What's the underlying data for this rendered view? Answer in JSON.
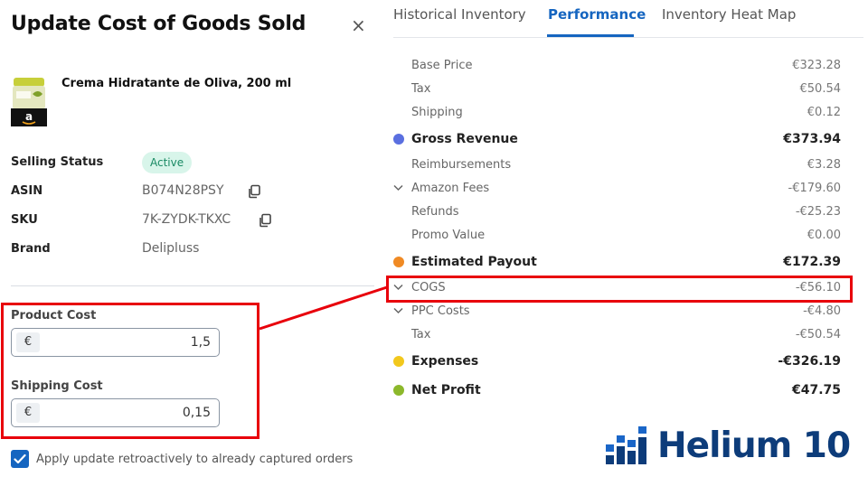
{
  "panel": {
    "title": "Update Cost of Goods Sold",
    "close_label": "×"
  },
  "product": {
    "name": "Crema Hidratante de Oliva, 200 ml",
    "image_icon": "product-jar-icon",
    "marketplace_icon": "amazon-icon"
  },
  "details": [
    {
      "label": "Selling Status",
      "value": "Active",
      "type": "badge"
    },
    {
      "label": "ASIN",
      "value": "B074N28PSY",
      "type": "copy"
    },
    {
      "label": "SKU",
      "value": "7K-ZYDK-TKXC",
      "type": "copy"
    },
    {
      "label": "Brand",
      "value": "Delipluss",
      "type": "text"
    }
  ],
  "costs": {
    "product_cost": {
      "label": "Product Cost",
      "currency": "€",
      "value": "1,5"
    },
    "shipping_cost": {
      "label": "Shipping Cost",
      "currency": "€",
      "value": "0,15"
    }
  },
  "retroactive": {
    "checked": true,
    "label": "Apply update retroactively to already captured orders"
  },
  "tabs": [
    {
      "label": "Historical Inventory",
      "active": false
    },
    {
      "label": "Performance",
      "active": true
    },
    {
      "label": "Inventory Heat Map",
      "active": false
    }
  ],
  "performance": [
    {
      "label": "Base Price",
      "value": "€323.28",
      "kind": "sub"
    },
    {
      "label": "Tax",
      "value": "€50.54",
      "kind": "sub"
    },
    {
      "label": "Shipping",
      "value": "€0.12",
      "kind": "sub"
    },
    {
      "label": "Gross Revenue",
      "value": "€373.94",
      "kind": "major",
      "dot": "#5a6fe0"
    },
    {
      "label": "Reimbursements",
      "value": "€3.28",
      "kind": "sub"
    },
    {
      "label": "Amazon Fees",
      "value": "-€179.60",
      "kind": "sub",
      "expandable": true
    },
    {
      "label": "Refunds",
      "value": "-€25.23",
      "kind": "sub"
    },
    {
      "label": "Promo Value",
      "value": "€0.00",
      "kind": "sub"
    },
    {
      "label": "Estimated Payout",
      "value": "€172.39",
      "kind": "major",
      "dot": "#f08a24"
    },
    {
      "label": "COGS",
      "value": "-€56.10",
      "kind": "sub",
      "expandable": true
    },
    {
      "label": "PPC Costs",
      "value": "-€4.80",
      "kind": "sub",
      "expandable": true
    },
    {
      "label": "Tax",
      "value": "-€50.54",
      "kind": "sub"
    },
    {
      "label": "Expenses",
      "value": "-€326.19",
      "kind": "major",
      "dot": "#f2c81d"
    },
    {
      "label": "Net Profit",
      "value": "€47.75",
      "kind": "major",
      "dot": "#8cb82b"
    }
  ],
  "brand": {
    "logo_text": "Helium 10",
    "logo_color": "#0d3c7a"
  },
  "colors": {
    "accent": "#1565c0",
    "highlight": "#e8000b",
    "badge_bg": "#d8f5ea",
    "badge_text": "#1a8a64"
  }
}
